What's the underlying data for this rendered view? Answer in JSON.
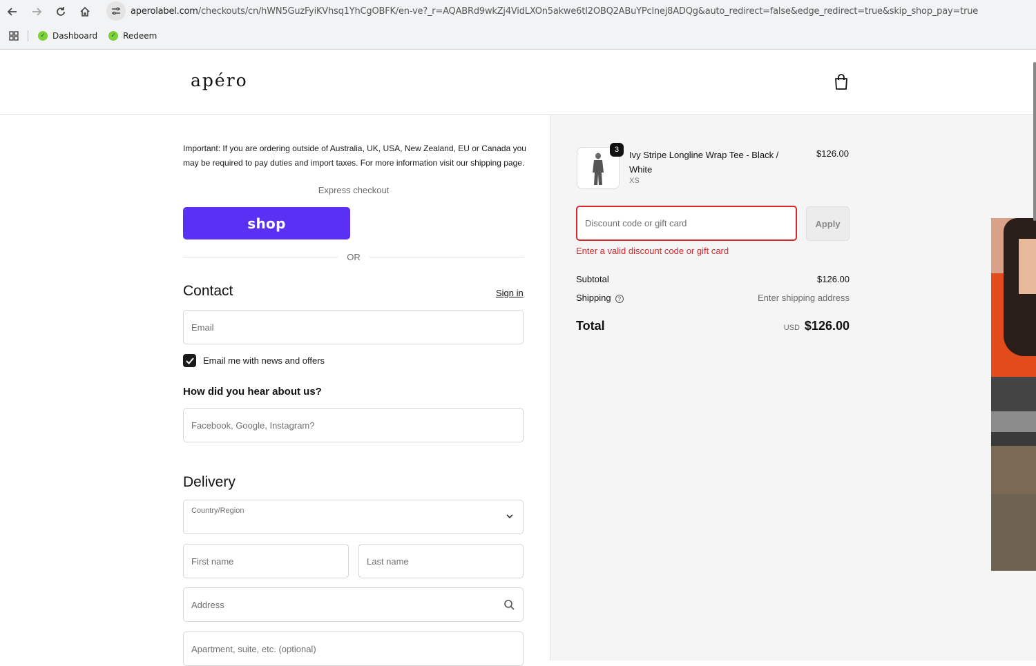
{
  "browser": {
    "url_host": "aperolabel.com",
    "url_path": "/checkouts/cn/hWN5GuzFyiKVhsq1YhCgOBFK/en-ve?_r=AQABRd9wkZj4VidLXOn5akwe6tI2OBQ2ABuYPclnej8ADQg&auto_redirect=false&edge_redirect=true&skip_shop_pay=true",
    "bookmarks": [
      {
        "label": "Dashboard",
        "icon": "leaf-icon"
      },
      {
        "label": "Redeem",
        "icon": "leaf-icon"
      }
    ]
  },
  "store": {
    "logo": "apéro"
  },
  "checkout": {
    "notice": "Important: If you are ordering outside of Australia, UK, USA, New Zealand, EU or Canada you may be required to pay duties and import taxes. For more information visit our shipping page.",
    "express_label": "Express checkout",
    "shop_button": "shop",
    "or_text": "OR",
    "contact_heading": "Contact",
    "signin_label": "Sign in",
    "email_placeholder": "Email",
    "newsletter_label": "Email me with news and offers",
    "newsletter_checked": true,
    "hear_heading": "How did you hear about us?",
    "hear_placeholder": "Facebook, Google, Instagram?",
    "delivery_heading": "Delivery",
    "country_label": "Country/Region",
    "country_value": "",
    "first_name_placeholder": "First name",
    "last_name_placeholder": "Last name",
    "address_placeholder": "Address",
    "apartment_placeholder": "Apartment, suite, etc. (optional)"
  },
  "summary": {
    "item": {
      "name": "Ivy Stripe Longline Wrap Tee - Black / White",
      "variant": "XS",
      "price": "$126.00",
      "quantity": "3"
    },
    "discount_placeholder": "Discount code or gift card",
    "apply_label": "Apply",
    "error": "Enter a valid discount code or gift card",
    "subtotal_label": "Subtotal",
    "subtotal_value": "$126.00",
    "shipping_label": "Shipping",
    "shipping_value": "Enter shipping address",
    "total_label": "Total",
    "currency": "USD",
    "total_value": "$126.00"
  },
  "colors": {
    "shop_pay": "#5a31f4",
    "error": "#d9272e"
  }
}
